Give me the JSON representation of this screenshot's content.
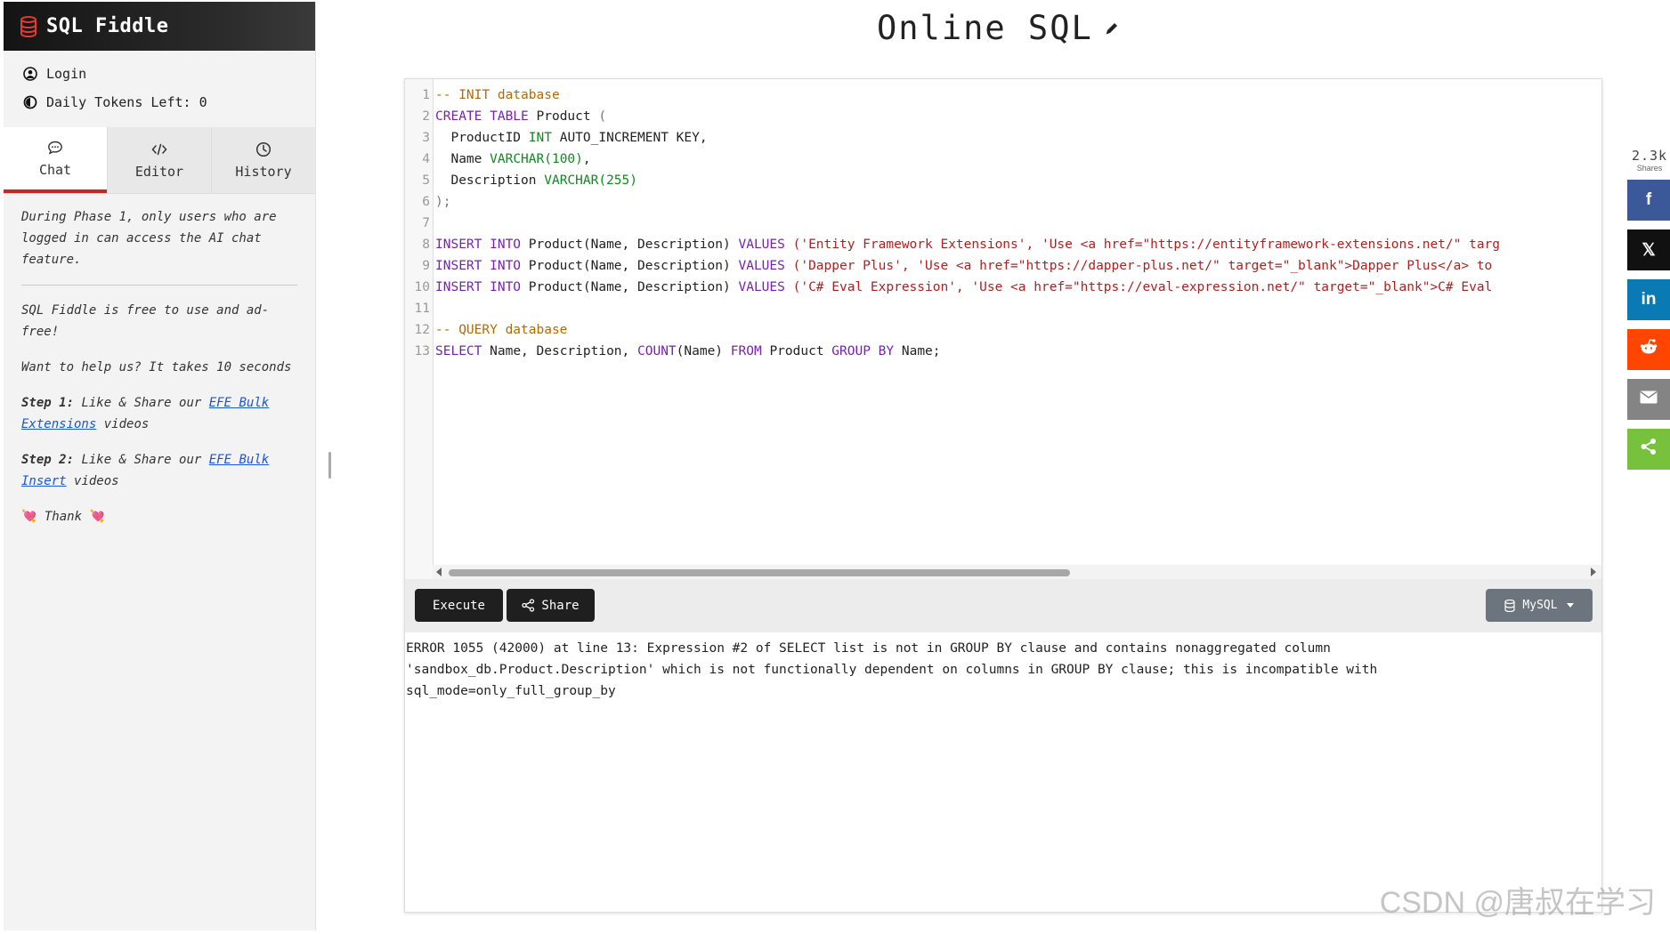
{
  "app": {
    "name": "SQL Fiddle",
    "page_title": "Online SQL"
  },
  "user": {
    "login_label": "Login",
    "tokens_label": "Daily Tokens Left: 0"
  },
  "tabs": [
    {
      "label": "Chat",
      "icon": "chat-icon",
      "active": true
    },
    {
      "label": "Editor",
      "icon": "code-icon",
      "active": false
    },
    {
      "label": "History",
      "icon": "clock-icon",
      "active": false
    }
  ],
  "chat": {
    "notice": "During Phase 1, only users who are logged in can access the AI chat feature.",
    "free_text": "SQL Fiddle is free to use and ad-free!",
    "help_text": "Want to help us? It takes 10 seconds",
    "step1_label": "Step 1:",
    "step1_text": "Like & Share our",
    "step1_link": "EFE Bulk Extensions",
    "step1_tail": "videos",
    "step2_label": "Step 2:",
    "step2_text": "Like & Share our",
    "step2_link": "EFE Bulk Insert",
    "step2_tail": "videos",
    "thanks": "Thank"
  },
  "editor": {
    "line_numbers": [
      "1",
      "2",
      "3",
      "4",
      "5",
      "6",
      "7",
      "8",
      "9",
      "10",
      "11",
      "12",
      "13"
    ],
    "code": {
      "l1": "-- INIT database",
      "l2_kw": "CREATE TABLE",
      "l2_name": "Product",
      "l2_p": "(",
      "l3_a": "ProductID",
      "l3_ty": "INT",
      "l3_b": "AUTO_INCREMENT KEY,",
      "l4_a": "Name",
      "l4_ty": "VARCHAR",
      "l4_num": "(100)",
      "l4_b": ",",
      "l5_a": "Description",
      "l5_ty": "VARCHAR",
      "l5_num": "(255)",
      "l6": ");",
      "ins_kw": "INSERT INTO",
      "ins_tbl": "Product",
      "ins_cols": "(Name, Description)",
      "values_kw": "VALUES",
      "l8_vals": "('Entity Framework Extensions', 'Use <a href=\"https://entityframework-extensions.net/\" targ",
      "l9_vals": "('Dapper Plus', 'Use <a href=\"https://dapper-plus.net/\" target=\"_blank\">Dapper Plus</a> to",
      "l10_vals": "('C# Eval Expression', 'Use <a href=\"https://eval-expression.net/\" target=\"_blank\">C# Eval",
      "l12": "-- QUERY database",
      "l13_select": "SELECT",
      "l13_cols": "Name, Description,",
      "l13_count": "COUNT",
      "l13_countarg": "(Name)",
      "l13_from": "FROM",
      "l13_tbl": "Product",
      "l13_group": "GROUP BY",
      "l13_tail": "Name;"
    }
  },
  "toolbar": {
    "execute_label": "Execute",
    "share_label": "Share",
    "db_label": "MySQL"
  },
  "output": {
    "error_text": "ERROR 1055 (42000) at line 13: Expression #2 of SELECT list is not in GROUP BY clause and contains nonaggregated column 'sandbox_db.Product.Description' which is not functionally dependent on columns in GROUP BY clause; this is incompatible with sql_mode=only_full_group_by"
  },
  "share_bar": {
    "count": "2.3k",
    "count_label": "Shares",
    "facebook": "f",
    "x": "𝕏",
    "linkedin": "in"
  },
  "watermark": "CSDN @唐叔在学习",
  "colors": {
    "accent_red": "#c62828",
    "facebook": "#3b5998",
    "linkedin": "#0a7ab5",
    "reddit": "#ff4500",
    "email": "#848484",
    "sharethis": "#77c13d"
  }
}
